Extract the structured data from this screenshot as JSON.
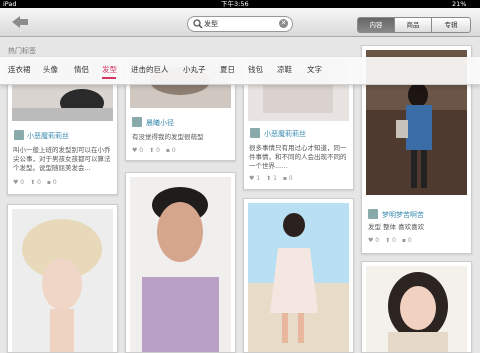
{
  "status": {
    "device": "iPad",
    "time": "下午3:56",
    "battery": "21%"
  },
  "nav": {
    "search_query": "发型",
    "segments": [
      "内容",
      "商品",
      "专辑"
    ],
    "active_segment": 0
  },
  "hot": {
    "label": "热门标签",
    "tags": [
      "连衣裙",
      "头像",
      "情侣",
      "发型",
      "进击的巨人",
      "小丸子",
      "夏日",
      "钱包",
      "凉鞋",
      "文字"
    ],
    "active": 3
  },
  "cards": [
    {
      "author": "小恶魔莉莉丝",
      "desc": "叫小一般上班的发型别可以在小乔尖公事，对于男孩女孩都可以算法个发型。说型随屈美发会...",
      "likes": "0",
      "comments": "0",
      "favs": "0"
    },
    {
      "author": "晨曦小径",
      "desc": "有没觉得我的发型很萌型",
      "likes": "0",
      "comments": "0",
      "favs": "0"
    },
    {
      "author": "小恶魔莉莉丝",
      "desc": "很多事情只有用过心才知道，同一件事情，和不同的人会出现不同的一个世界......",
      "likes": "1",
      "comments": "1",
      "favs": "0"
    },
    {
      "author": "梦明梦苦啊苦",
      "desc": "发型 整体 喜欢喜欢",
      "likes": "0",
      "comments": "0",
      "favs": "0"
    }
  ],
  "icons": {
    "back": "back-arrow-icon",
    "search": "search-icon",
    "clear": "clear-icon",
    "avatar": "avatar-icon"
  }
}
